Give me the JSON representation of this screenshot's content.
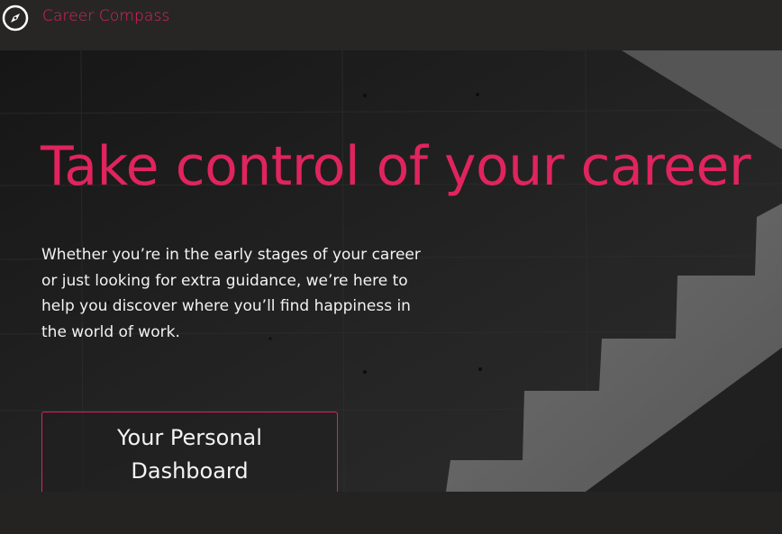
{
  "navbar": {
    "brand": "Career Compass",
    "logo_icon": "compass-icon",
    "accent_color": "#e0245e"
  },
  "hero": {
    "background": "dark concrete staircase photo",
    "headline": "Take control of your career",
    "intro": "Whether you’re in the early stages of your career or just looking for extra guidance, we’re here to help you discover where you’ll find happiness in the world of work.",
    "cta_label": "Your Personal Dashboard"
  }
}
